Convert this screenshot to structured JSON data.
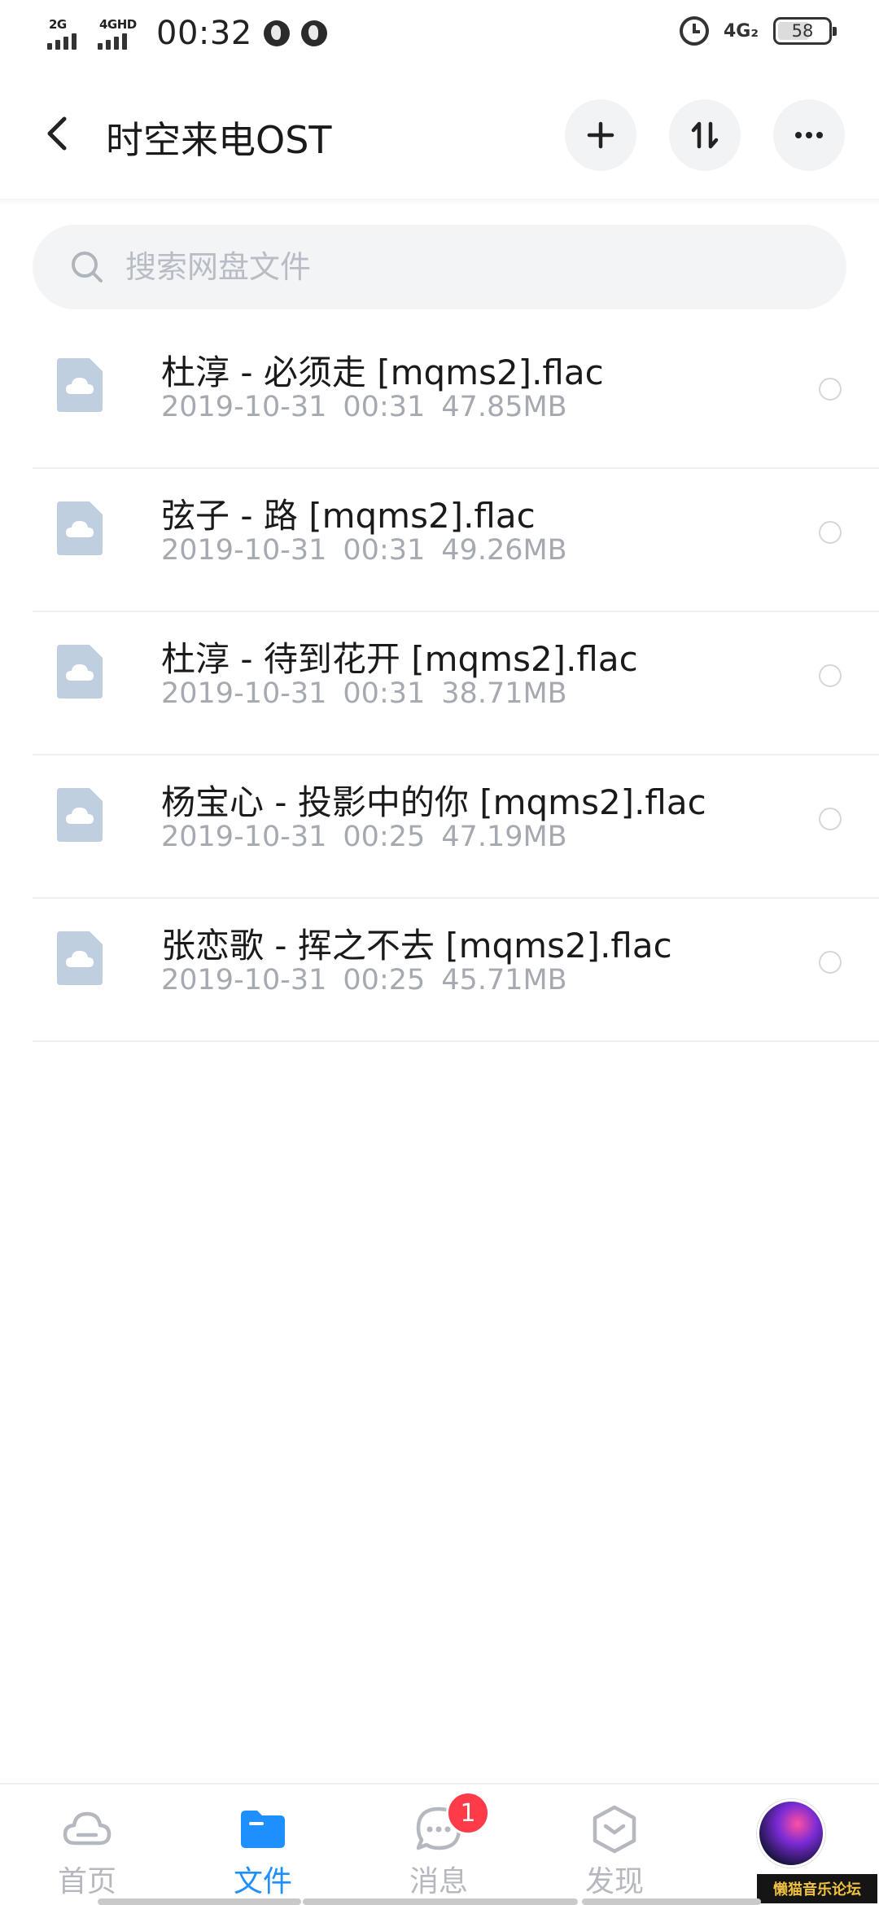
{
  "status_bar": {
    "signal_1_label": "2G",
    "signal_2_label": "4GHD",
    "time": "00:32",
    "network_label": "4G₂",
    "battery_level": "58"
  },
  "header": {
    "title": "时空来电OST",
    "back_icon": "chevron-left-icon",
    "add_icon": "plus-icon",
    "sort_icon": "sort-arrows-icon",
    "more_icon": "ellipsis-icon"
  },
  "search": {
    "placeholder": "搜索网盘文件"
  },
  "files": [
    {
      "name": "杜淳 - 必须走 [mqms2].flac",
      "date": "2019-10-31",
      "time": "00:31",
      "size": "47.85MB"
    },
    {
      "name": "弦子 - 路 [mqms2].flac",
      "date": "2019-10-31",
      "time": "00:31",
      "size": "49.26MB"
    },
    {
      "name": "杜淳 - 待到花开 [mqms2].flac",
      "date": "2019-10-31",
      "time": "00:31",
      "size": "38.71MB"
    },
    {
      "name": "杨宝心 - 投影中的你 [mqms2].flac",
      "date": "2019-10-31",
      "time": "00:25",
      "size": "47.19MB"
    },
    {
      "name": "张恋歌 - 挥之不去 [mqms2].flac",
      "date": "2019-10-31",
      "time": "00:25",
      "size": "45.71MB"
    }
  ],
  "bottom_nav": {
    "home": "首页",
    "files": "文件",
    "messages": "消息",
    "messages_badge": "1",
    "discover": "发现",
    "active": "文件"
  },
  "watermark": "懒猫音乐论坛",
  "colors": {
    "accent": "#1e8fff",
    "badge": "#ff3b4a",
    "file_icon": "#bfcfe0",
    "meta_text": "#a5a9b0"
  }
}
